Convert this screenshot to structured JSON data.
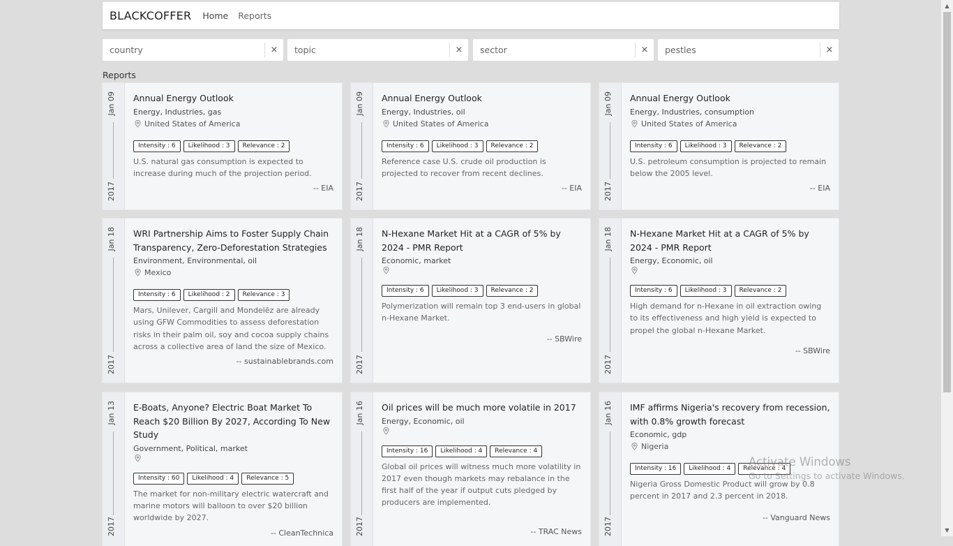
{
  "navbar": {
    "brand": "BLACKCOFFER",
    "links": [
      "Home",
      "Reports"
    ]
  },
  "filters": [
    {
      "placeholder": "country"
    },
    {
      "placeholder": "topic"
    },
    {
      "placeholder": "sector"
    },
    {
      "placeholder": "pestles"
    }
  ],
  "clear_symbol": "×",
  "section_title": "Reports",
  "cards": [
    {
      "month": "Jan 09",
      "year": "2017",
      "title": "Annual Energy Outlook",
      "tags": "Energy, Industries, gas",
      "location": "United States of America",
      "intensity": "Intensity : 6",
      "likelihood": "Likelihood : 3",
      "relevance": "Relevance : 2",
      "description": "U.S. natural gas consumption is expected to increase during much of the projection period.",
      "source": "-- EIA"
    },
    {
      "month": "Jan 09",
      "year": "2017",
      "title": "Annual Energy Outlook",
      "tags": "Energy, Industries, oil",
      "location": "United States of America",
      "intensity": "Intensity : 6",
      "likelihood": "Likelihood : 3",
      "relevance": "Relevance : 2",
      "description": "Reference case U.S. crude oil production is projected to recover from recent declines.",
      "source": "-- EIA"
    },
    {
      "month": "Jan 09",
      "year": "2017",
      "title": "Annual Energy Outlook",
      "tags": "Energy, Industries, consumption",
      "location": "United States of America",
      "intensity": "Intensity : 6",
      "likelihood": "Likelihood : 3",
      "relevance": "Relevance : 2",
      "description": "U.S. petroleum consumption is projected to remain below the 2005 level.",
      "source": "-- EIA"
    },
    {
      "month": "Jan 18",
      "year": "2017",
      "title": "WRI Partnership Aims to Foster Supply Chain Transparency, Zero-Deforestation Strategies",
      "tags": "Environment, Environmental, oil",
      "location": "Mexico",
      "intensity": "Intensity : 6",
      "likelihood": "Likelihood : 2",
      "relevance": "Relevance : 3",
      "description": "Mars, Unilever, Cargill and Mondelēz are already using GFW Commodities to assess deforestation risks in their palm oil, soy and cocoa supply chains across a collective area of land the size of Mexico.",
      "source": "-- sustainablebrands.com"
    },
    {
      "month": "Jan 18",
      "year": "2017",
      "title": "N-Hexane Market Hit at a CAGR of 5% by 2024 - PMR Report",
      "tags": "Economic, market",
      "location": "",
      "intensity": "Intensity : 6",
      "likelihood": "Likelihood : 3",
      "relevance": "Relevance : 2",
      "description": "Polymerization will remain top 3 end-users in global n-Hexane Market.",
      "source": "-- SBWire"
    },
    {
      "month": "Jan 18",
      "year": "2017",
      "title": "N-Hexane Market Hit at a CAGR of 5% by 2024 - PMR Report",
      "tags": "Energy, Economic, oil",
      "location": "",
      "intensity": "Intensity : 6",
      "likelihood": "Likelihood : 3",
      "relevance": "Relevance : 2",
      "description": "High demand for n-Hexane in oil extraction owing to its effectiveness and high yield is expected to propel the global n-Hexane Market.",
      "source": "-- SBWire"
    },
    {
      "month": "Jan 13",
      "year": "2017",
      "title": "E-Boats, Anyone? Electric Boat Market To Reach $20 Billion By 2027, According To New Study",
      "tags": "Government, Political, market",
      "location": "",
      "intensity": "Intensity : 60",
      "likelihood": "Likelihood : 4",
      "relevance": "Relevance : 5",
      "description": "The market for non-military electric watercraft and marine motors will balloon to over $20 billion worldwide by 2027.",
      "source": "-- CleanTechnica"
    },
    {
      "month": "Jan 16",
      "year": "2017",
      "title": "Oil prices will be much more volatile in 2017",
      "tags": "Energy, Economic, oil",
      "location": "",
      "intensity": "Intensity : 16",
      "likelihood": "Likelihood : 4",
      "relevance": "Relevance : 4",
      "description": "Global oil prices will witness much more volatility in 2017 even though markets may rebalance in the first half of the year if output cuts pledged by producers are implemented.",
      "source": "-- TRAC News"
    },
    {
      "month": "Jan 16",
      "year": "2017",
      "title": "IMF affirms Nigeria's recovery from recession, with 0.8% growth forecast",
      "tags": "Economic, gdp",
      "location": "Nigeria",
      "intensity": "Intensity : 16",
      "likelihood": "Likelihood : 4",
      "relevance": "Relevance : 4",
      "description": "Nigeria Gross Domestic Product will grow by 0.8 percent in 2017 and 2.3 percent in 2018.",
      "source": "-- Vanguard News"
    }
  ],
  "watermark": {
    "line1": "Activate Windows",
    "line2": "Go to Settings to activate Windows."
  },
  "scrollbar": {
    "up": "▲",
    "down": "▼"
  }
}
